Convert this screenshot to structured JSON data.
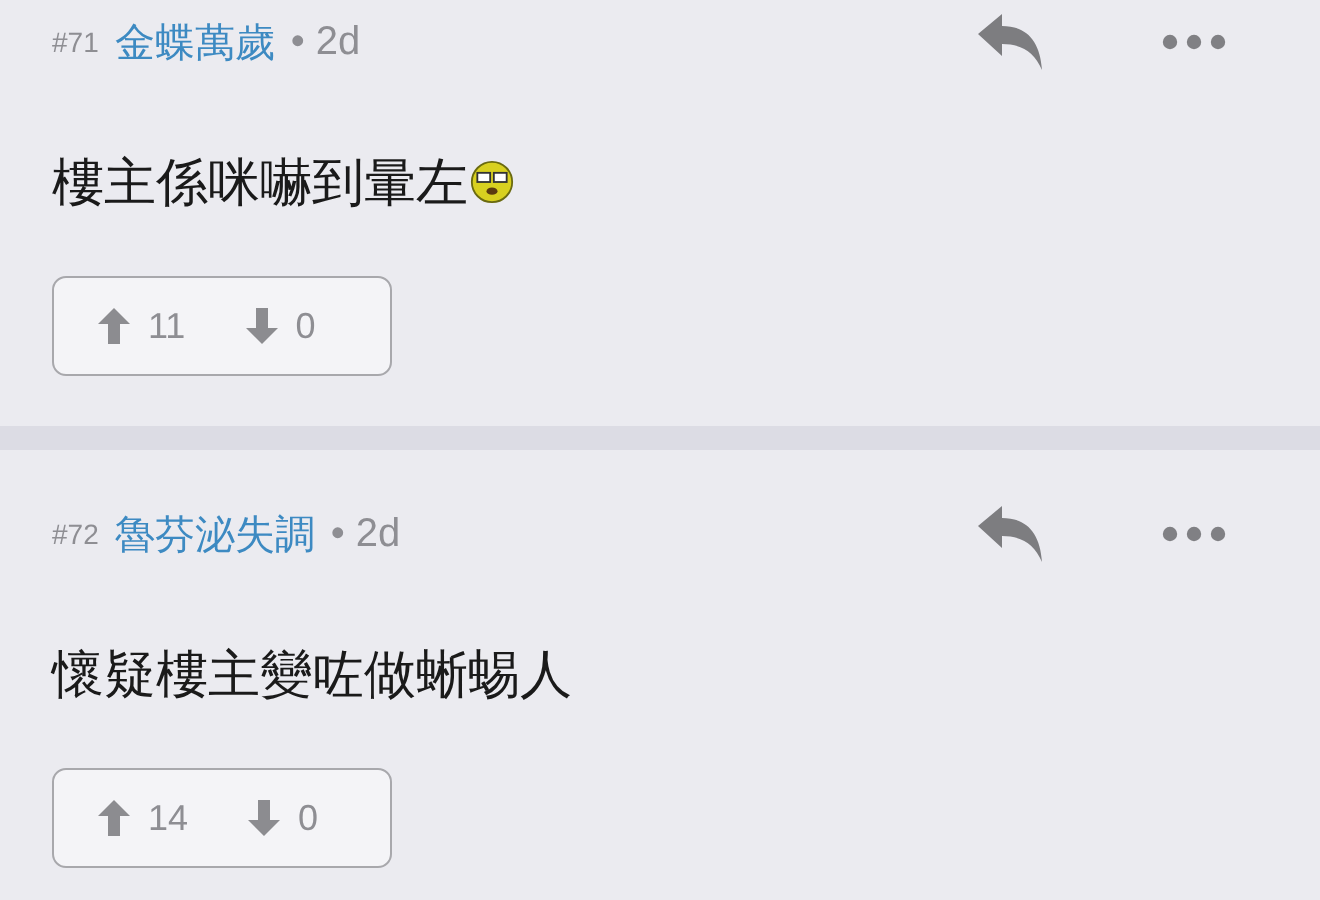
{
  "posts": [
    {
      "number": "#71",
      "author": "金蝶萬歲",
      "age": "• 2d",
      "body": "樓主係咪嚇到暈左",
      "has_emoticon": true,
      "upvotes": "11",
      "downvotes": "0"
    },
    {
      "number": "#72",
      "author": "魯芬泌失調",
      "age": "• 2d",
      "body": "懷疑樓主變咗做蜥蜴人",
      "has_emoticon": false,
      "upvotes": "14",
      "downvotes": "0"
    }
  ]
}
